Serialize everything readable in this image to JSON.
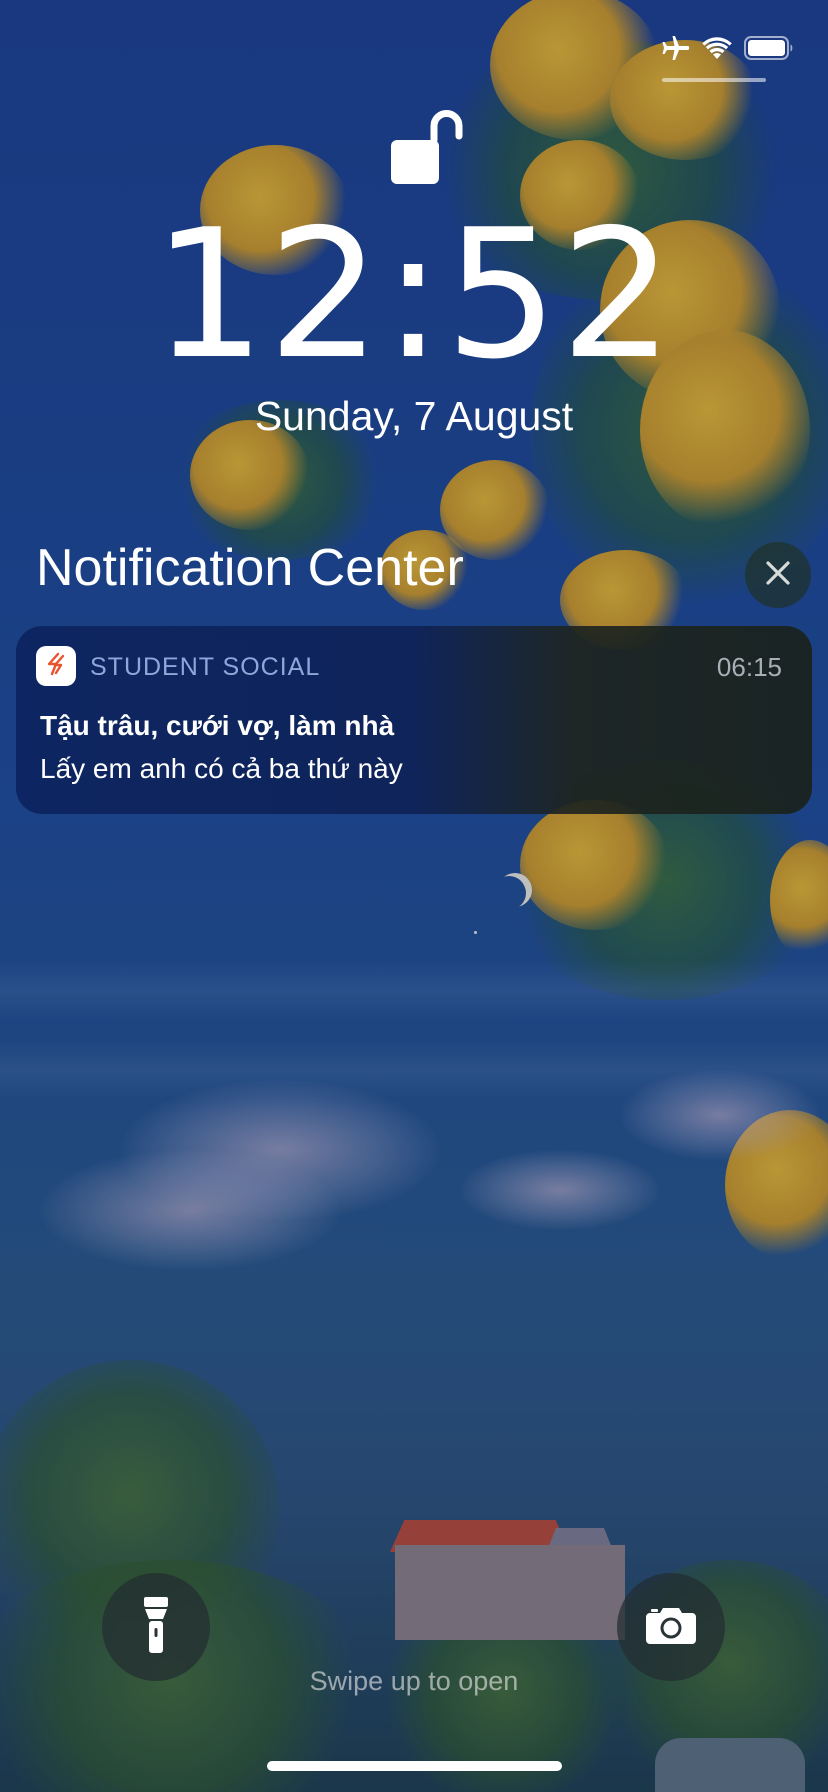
{
  "status_bar": {
    "icons": [
      "airplane-icon",
      "wifi-icon",
      "battery-icon"
    ]
  },
  "lock_screen": {
    "lock_icon": "unlocked-padlock-icon",
    "time": "12:52",
    "date": "Sunday, 7 August"
  },
  "notification_center": {
    "title": "Notification Center",
    "close_icon": "close-icon"
  },
  "notification": {
    "app_name": "STUDENT SOCIAL",
    "time": "06:15",
    "title": "Tậu trâu, cưới vợ, làm nhà",
    "body": "Lấy em anh có cả ba thứ này",
    "accent_color": "#e8542d"
  },
  "bottom_bar": {
    "flashlight_icon": "flashlight-icon",
    "camera_icon": "camera-icon",
    "swipe_hint": "Swipe up to open"
  }
}
